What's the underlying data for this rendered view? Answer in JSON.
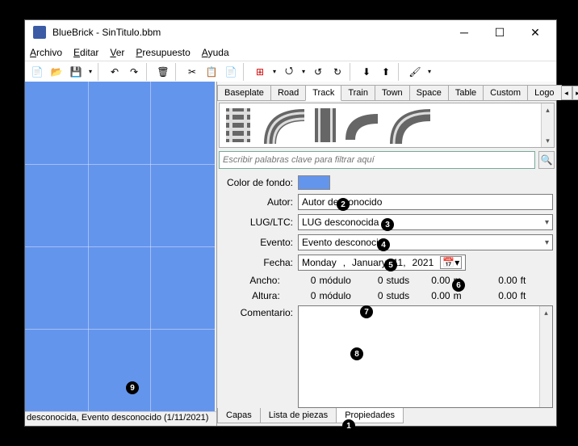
{
  "window": {
    "title": "BlueBrick - SinTitulo.bbm"
  },
  "menu": {
    "file": "Archivo",
    "edit": "Editar",
    "view": "Ver",
    "budget": "Presupuesto",
    "help": "Ayuda"
  },
  "tabs": {
    "baseplate": "Baseplate",
    "road": "Road",
    "track": "Track",
    "train": "Train",
    "town": "Town",
    "space": "Space",
    "table": "Table",
    "custom": "Custom",
    "logo": "Logo"
  },
  "filter": {
    "placeholder": "Escribir palabras clave para filtrar aquí"
  },
  "props": {
    "bgcolor_label": "Color de fondo:",
    "bgcolor": "#6495ed",
    "author_label": "Autor:",
    "author": "Autor desconocido",
    "lug_label": "LUG/LTC:",
    "lug": "LUG desconocida",
    "event_label": "Evento:",
    "event": "Evento desconocido",
    "date_label": "Fecha:",
    "date_weekday": "Monday",
    "date_month": "January",
    "date_day": "11,",
    "date_year": "2021",
    "width_label": "Ancho:",
    "height_label": "Altura:",
    "comment_label": "Comentario:",
    "w_modulo": "0",
    "w_modulo_u": "módulo",
    "w_studs": "0",
    "w_studs_u": "studs",
    "w_m": "0.00",
    "w_m_u": "m",
    "w_ft": "0.00",
    "w_ft_u": "ft",
    "h_modulo": "0",
    "h_modulo_u": "módulo",
    "h_studs": "0",
    "h_studs_u": "studs",
    "h_m": "0.00",
    "h_m_u": "m",
    "h_ft": "0.00",
    "h_ft_u": "ft"
  },
  "bottom_tabs": {
    "layers": "Capas",
    "partslist": "Lista de piezas",
    "properties": "Propiedades"
  },
  "statusbar": "desconocida, Evento desconocido (1/11/2021)",
  "markers": {
    "m1": "1",
    "m2": "2",
    "m3": "3",
    "m4": "4",
    "m5": "5",
    "m6": "6",
    "m7": "7",
    "m8": "8",
    "m9": "9"
  }
}
